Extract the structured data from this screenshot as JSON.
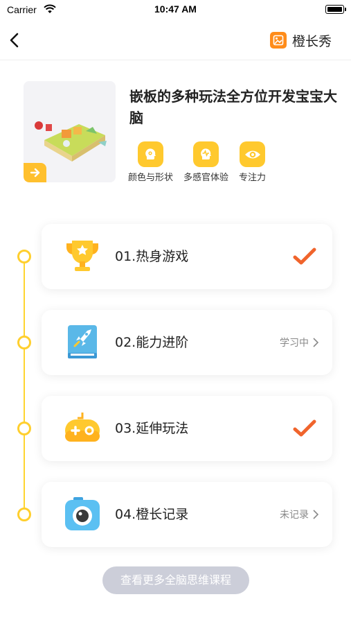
{
  "status_bar": {
    "carrier": "Carrier",
    "time": "10:47 AM"
  },
  "nav": {
    "back_icon": "chevron-left-icon",
    "show_label": "橙长秀",
    "show_icon": "image-icon"
  },
  "hero": {
    "title": "嵌板的多种玩法全方位开发宝宝大脑",
    "thumbnail_alt": "puzzle-board-toy-image",
    "tags": [
      {
        "label": "颜色与形状",
        "icon": "brain-gear-icon"
      },
      {
        "label": "多感官体验",
        "icon": "brain-pulse-icon"
      },
      {
        "label": "专注力",
        "icon": "eye-icon"
      }
    ]
  },
  "steps": [
    {
      "title": "01.热身游戏",
      "status": "",
      "done": true,
      "icon": "trophy-icon"
    },
    {
      "title": "02.能力进阶",
      "status": "学习中",
      "done": false,
      "icon": "rocket-book-icon"
    },
    {
      "title": "03.延伸玩法",
      "status": "",
      "done": true,
      "icon": "gamepad-icon"
    },
    {
      "title": "04.橙长记录",
      "status": "未记录",
      "done": false,
      "icon": "camera-icon"
    }
  ],
  "more_button": "查看更多全脑思维课程",
  "colors": {
    "accent": "#ffc92e",
    "check": "#f0642c",
    "brand": "#ff8c1a",
    "disabled_button": "#ccced9"
  }
}
